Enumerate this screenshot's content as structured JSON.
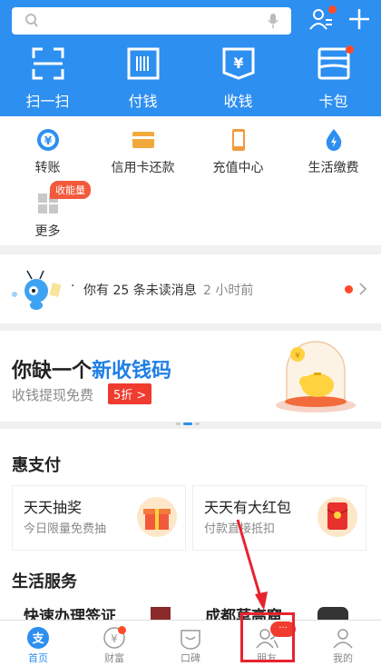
{
  "header": {
    "search_placeholder": "",
    "quick_actions": [
      {
        "label": "扫一扫",
        "icon": "scan-icon"
      },
      {
        "label": "付钱",
        "icon": "barcode-icon"
      },
      {
        "label": "收钱",
        "icon": "yuan-receive-icon"
      },
      {
        "label": "卡包",
        "icon": "card-wallet-icon"
      }
    ]
  },
  "grid": {
    "items": [
      {
        "label": "转账",
        "icon": "transfer-icon"
      },
      {
        "label": "信用卡还款",
        "icon": "credit-card-icon"
      },
      {
        "label": "充值中心",
        "icon": "phone-recharge-icon"
      },
      {
        "label": "生活缴费",
        "icon": "utility-drop-icon"
      },
      {
        "label": "更多",
        "icon": "more-grid-icon"
      }
    ],
    "badge": "收能量"
  },
  "message": {
    "text": "你有 25 条未读消息",
    "time": "2 小时前"
  },
  "banner": {
    "title_prefix": "你缺一个",
    "title_highlight": "新收钱码",
    "subtitle": "收钱提现免费",
    "tag": "5折 >"
  },
  "promo_section": {
    "title": "惠支付",
    "cards": [
      {
        "title": "天天抽奖",
        "subtitle": "今日限量免费抽"
      },
      {
        "title": "天天有大红包",
        "subtitle": "付款直接抵扣"
      }
    ]
  },
  "life_section": {
    "title": "生活服务",
    "items": [
      "快速办理签证",
      "成都莫高窟"
    ]
  },
  "tabbar": {
    "tabs": [
      {
        "label": "首页",
        "icon": "home-icon",
        "active": true
      },
      {
        "label": "财富",
        "icon": "wealth-icon",
        "active": false
      },
      {
        "label": "口碑",
        "icon": "koubei-icon",
        "active": false
      },
      {
        "label": "朋友",
        "icon": "friends-icon",
        "active": false
      },
      {
        "label": "我的",
        "icon": "profile-icon",
        "active": false
      }
    ],
    "friends_badge": "···"
  },
  "colors": {
    "brand_blue": "#2d8ff0",
    "alert_red": "#f03b2f"
  }
}
